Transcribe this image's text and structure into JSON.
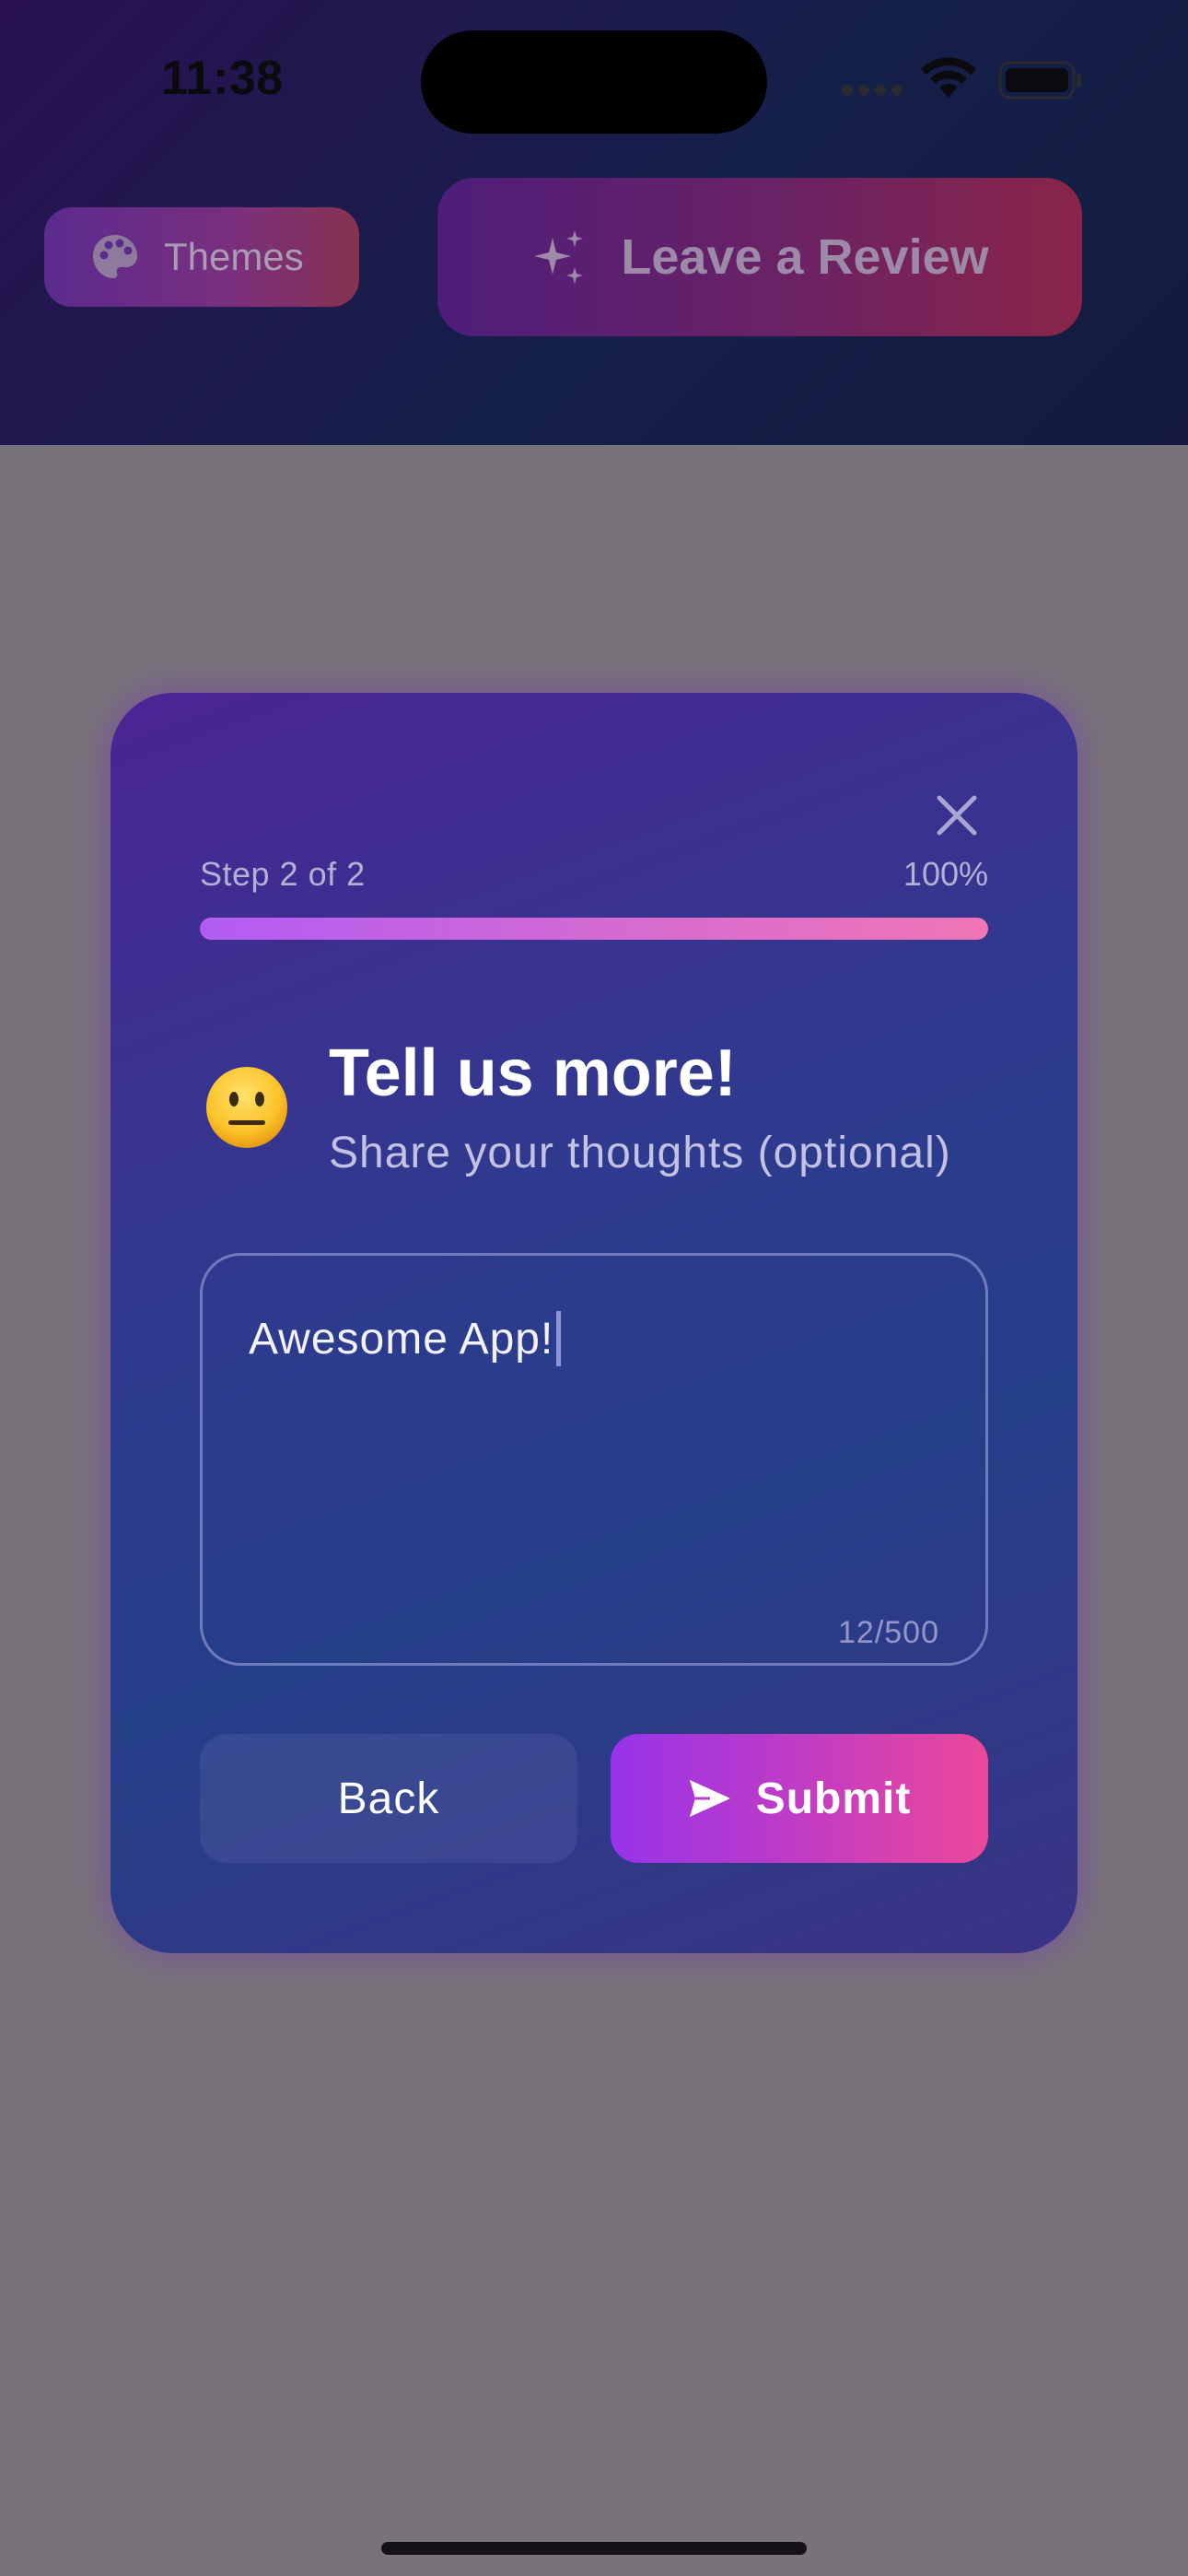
{
  "status_bar": {
    "time": "11:38",
    "icons": [
      "signal-icon",
      "wifi-icon",
      "battery-icon"
    ]
  },
  "header": {
    "themes_label": "Themes",
    "themes_icon": "palette-icon",
    "review_label": "Leave a Review",
    "review_icon": "sparkle-icon"
  },
  "modal": {
    "close_icon": "close-icon",
    "step_label": "Step 2 of 2",
    "progress_label": "100%",
    "progress_fraction": 1.0,
    "emoji": "neutral-face-emoji",
    "title": "Tell us more!",
    "subtitle": "Share your thoughts (optional)",
    "textarea": {
      "value": "Awesome App!",
      "counter": "12/500"
    },
    "back_label": "Back",
    "submit_label": "Submit",
    "submit_icon": "send-icon"
  },
  "colors": {
    "overlay": "#78737a",
    "accent_start": "#9733ea",
    "accent_end": "#ec4899",
    "card_top": "#4b2493",
    "card_mid": "#253f89"
  }
}
